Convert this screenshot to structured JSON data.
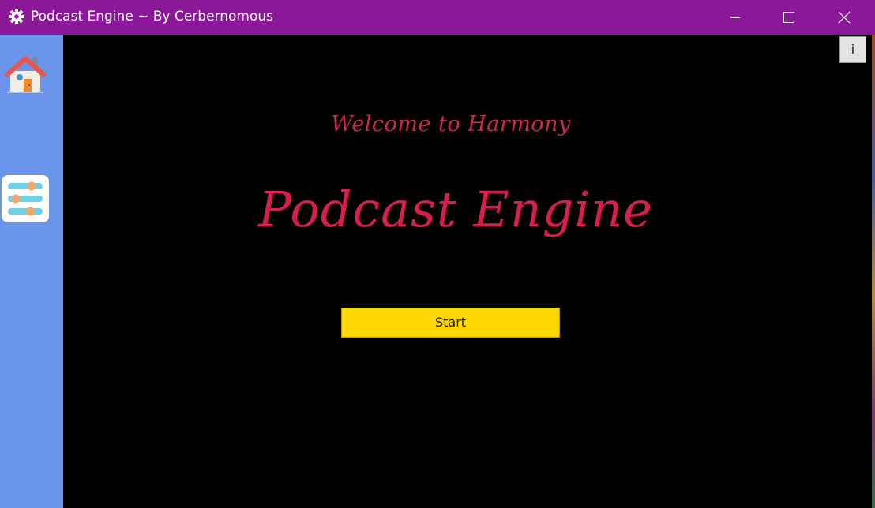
{
  "window": {
    "title": "Podcast Engine ~ By Cerbernomous",
    "app_icon": "gear-icon",
    "controls": [
      "minimize-icon",
      "maximize-icon",
      "close-icon"
    ],
    "titlebar_color": "#8a1898"
  },
  "sidebar": {
    "background": "#6b95ea",
    "items": [
      {
        "icon": "home-icon"
      },
      {
        "icon": "settings-sliders-icon"
      }
    ]
  },
  "main": {
    "info_label": "i",
    "welcome": "Welcome to Harmony",
    "headline": "Podcast Engine",
    "start_label": "Start",
    "accent_color": "#d81e4c",
    "button_color": "#ffd700"
  }
}
